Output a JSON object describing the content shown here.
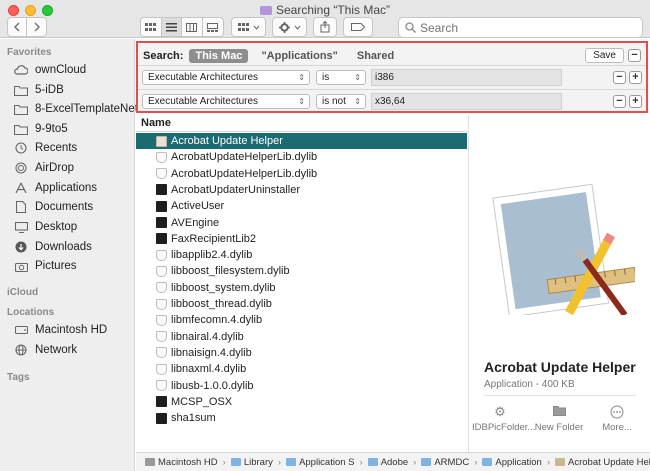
{
  "window": {
    "title": "Searching “This Mac”"
  },
  "toolbar": {
    "search_placeholder": "Search"
  },
  "sidebar": {
    "favorites_header": "Favorites",
    "favorites": [
      {
        "label": "ownCloud",
        "icon": "cloud-icon"
      },
      {
        "label": "5-iDB",
        "icon": "folder-icon"
      },
      {
        "label": "8-ExcelTemplateNet",
        "icon": "folder-icon"
      },
      {
        "label": "9-9to5",
        "icon": "folder-icon"
      },
      {
        "label": "Recents",
        "icon": "clock-icon"
      },
      {
        "label": "AirDrop",
        "icon": "airdrop-icon"
      },
      {
        "label": "Applications",
        "icon": "applications-icon"
      },
      {
        "label": "Documents",
        "icon": "document-icon"
      },
      {
        "label": "Desktop",
        "icon": "desktop-icon"
      },
      {
        "label": "Downloads",
        "icon": "download-icon"
      },
      {
        "label": "Pictures",
        "icon": "camera-icon"
      }
    ],
    "icloud_header": "iCloud",
    "locations_header": "Locations",
    "locations": [
      {
        "label": "Macintosh HD",
        "icon": "hard-drive-icon"
      },
      {
        "label": "Network",
        "icon": "globe-icon"
      }
    ],
    "tags_header": "Tags"
  },
  "search_criteria": {
    "label": "Search:",
    "scopes": [
      "This Mac",
      "\"Applications\"",
      "Shared"
    ],
    "selected_scope": "This Mac",
    "save_label": "Save",
    "rules": [
      {
        "attribute": "Executable Architectures",
        "operator": "is",
        "value": "i386"
      },
      {
        "attribute": "Executable Architectures",
        "operator": "is not",
        "value": "x36,64"
      }
    ]
  },
  "file_list": {
    "column_header": "Name",
    "selected_index": 0,
    "rows": [
      {
        "name": "Acrobat Update Helper",
        "kind": "app"
      },
      {
        "name": "AcrobatUpdateHelperLib.dylib",
        "kind": "lib"
      },
      {
        "name": "AcrobatUpdateHelperLib.dylib",
        "kind": "lib"
      },
      {
        "name": "AcrobatUpdaterUninstaller",
        "kind": "exec"
      },
      {
        "name": "ActiveUser",
        "kind": "exec"
      },
      {
        "name": "AVEngine",
        "kind": "exec"
      },
      {
        "name": "FaxRecipientLib2",
        "kind": "exec"
      },
      {
        "name": "libapplib2.4.dylib",
        "kind": "lib"
      },
      {
        "name": "libboost_filesystem.dylib",
        "kind": "lib"
      },
      {
        "name": "libboost_system.dylib",
        "kind": "lib"
      },
      {
        "name": "libboost_thread.dylib",
        "kind": "lib"
      },
      {
        "name": "libmfecomn.4.dylib",
        "kind": "lib"
      },
      {
        "name": "libnairal.4.dylib",
        "kind": "lib"
      },
      {
        "name": "libnaisign.4.dylib",
        "kind": "lib"
      },
      {
        "name": "libnaxml.4.dylib",
        "kind": "lib"
      },
      {
        "name": "libusb-1.0.0.dylib",
        "kind": "lib"
      },
      {
        "name": "MCSP_OSX",
        "kind": "exec"
      },
      {
        "name": "sha1sum",
        "kind": "exec"
      }
    ]
  },
  "preview": {
    "name": "Acrobat Update Helper",
    "kind": "Application - 400 KB",
    "actions": [
      {
        "label": "IDBPicFolder...",
        "icon": "gear-icon"
      },
      {
        "label": "New Folder",
        "icon": "new-folder-icon"
      },
      {
        "label": "More...",
        "icon": "more-icon"
      }
    ]
  },
  "path_bar": [
    "Macintosh HD",
    "Library",
    "Application S",
    "Adobe",
    "ARMDC",
    "Application",
    "Acrobat Update Helper"
  ],
  "colors": {
    "selection": "#1b6b72",
    "criteria_border": "#e0504a"
  }
}
